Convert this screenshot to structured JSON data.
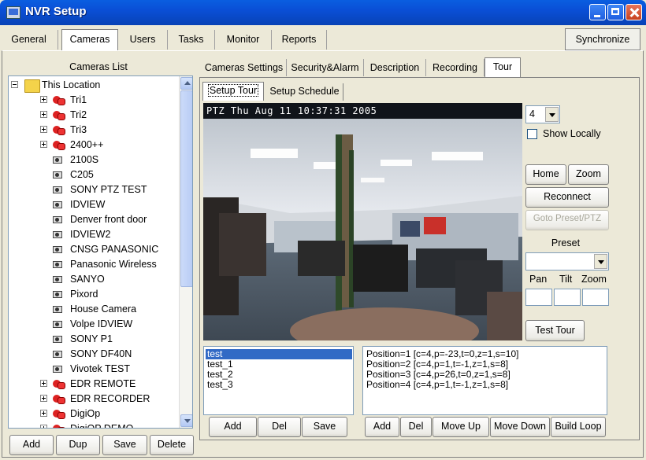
{
  "window": {
    "title": "NVR Setup"
  },
  "main_tabs": [
    "General",
    "Cameras",
    "Users",
    "Tasks",
    "Monitor",
    "Reports"
  ],
  "synchronize_label": "Synchronize",
  "cameras_list": {
    "label": "Cameras List",
    "root": "This Location",
    "items": [
      {
        "label": "Tri1",
        "type": "group"
      },
      {
        "label": "Tri2",
        "type": "group"
      },
      {
        "label": "Tri3",
        "type": "group"
      },
      {
        "label": "2400++",
        "type": "group"
      },
      {
        "label": "2100S",
        "type": "camera"
      },
      {
        "label": "C205",
        "type": "camera"
      },
      {
        "label": "SONY PTZ TEST",
        "type": "camera"
      },
      {
        "label": "IDVIEW",
        "type": "camera"
      },
      {
        "label": "Denver front door",
        "type": "camera"
      },
      {
        "label": "IDVIEW2",
        "type": "camera"
      },
      {
        "label": "CNSG PANASONIC",
        "type": "camera"
      },
      {
        "label": "Panasonic Wireless",
        "type": "camera"
      },
      {
        "label": "SANYO",
        "type": "camera"
      },
      {
        "label": "Pix​ord",
        "type": "camera"
      },
      {
        "label": "House Camera",
        "type": "camera"
      },
      {
        "label": "Volpe IDVIEW",
        "type": "camera"
      },
      {
        "label": "SONY P1",
        "type": "camera"
      },
      {
        "label": "SONY DF40N",
        "type": "camera"
      },
      {
        "label": "Vivotek TEST",
        "type": "camera"
      },
      {
        "label": "EDR REMOTE",
        "type": "group"
      },
      {
        "label": "EDR RECORDER",
        "type": "group"
      },
      {
        "label": "DigiOp",
        "type": "group"
      },
      {
        "label": "DigiOP DEMO",
        "type": "group"
      }
    ]
  },
  "left_buttons": [
    "Add",
    "Dup",
    "Save",
    "Delete"
  ],
  "sub_tabs": [
    "Cameras Settings",
    "Security&Alarm",
    "Description",
    "Recording",
    "Tour"
  ],
  "tour_tabs": [
    "Setup Tour",
    "Setup Schedule"
  ],
  "video": {
    "osd": "PTZ  Thu Aug 11  10:37:31  2005"
  },
  "camera_select_value": "4",
  "show_locally_label": "Show Locally",
  "ptz_buttons": {
    "home": "Home",
    "zoom": "Zoom",
    "reconnect": "Reconnect",
    "goto": "Goto Preset/PTZ"
  },
  "preset": {
    "label": "Preset",
    "value": ""
  },
  "ptz_fields": {
    "pan": "Pan",
    "tilt": "Tilt",
    "zoom": "Zoom"
  },
  "test_tour_label": "Test Tour",
  "tours": [
    "test",
    "test_1",
    "test_2",
    "test_3"
  ],
  "positions": [
    "Position=1  [c=4,p=-23,t=0,z=1,s=10]",
    "Position=2  [c=4,p=1,t=-1,z=1,s=8]",
    "Position=3  [c=4,p=26,t=0,z=1,s=8]",
    "Position=4  [c=4,p=1,t=-1,z=1,s=8]"
  ],
  "tour_buttons": [
    "Add",
    "Del",
    "Save"
  ],
  "position_buttons": [
    "Add",
    "Del",
    "Move Up",
    "Move Down",
    "Build Loop"
  ],
  "colors": {
    "titlebar": "#0a4fd6",
    "selection": "#316ac5",
    "window_bg": "#ece9d8"
  }
}
